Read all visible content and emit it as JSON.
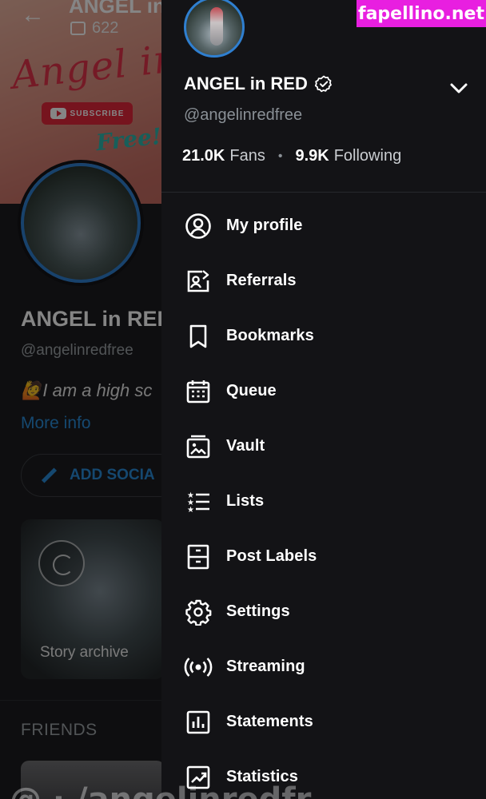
{
  "background": {
    "cover_title": "ANGEL in RED",
    "cover_script": "Angel in Red",
    "cover_free": "Free!",
    "subscribe_label": "SUBSCRIBE",
    "media_count": "622",
    "name": "ANGEL in RED",
    "handle": "@angelinredfree",
    "bio": "🙋I am a high sc",
    "more_info": "More info",
    "add_social": "ADD SOCIA",
    "story_label": "Story archive",
    "friends_heading": "FRIENDS"
  },
  "drawer": {
    "name": "ANGEL in RED",
    "handle": "@angelinredfree",
    "fans_count": "21.0K",
    "fans_label": "Fans",
    "following_count": "9.9K",
    "following_label": "Following",
    "menu": [
      {
        "label": "My profile",
        "icon": "profile-icon"
      },
      {
        "label": "Referrals",
        "icon": "referrals-icon"
      },
      {
        "label": "Bookmarks",
        "icon": "bookmark-icon"
      },
      {
        "label": "Queue",
        "icon": "calendar-icon"
      },
      {
        "label": "Vault",
        "icon": "vault-icon"
      },
      {
        "label": "Lists",
        "icon": "lists-icon"
      },
      {
        "label": "Post Labels",
        "icon": "post-labels-icon"
      },
      {
        "label": "Settings",
        "icon": "gear-icon"
      },
      {
        "label": "Streaming",
        "icon": "streaming-icon"
      },
      {
        "label": "Statements",
        "icon": "statements-icon"
      },
      {
        "label": "Statistics",
        "icon": "statistics-icon"
      }
    ]
  },
  "watermark": "fapellino.net",
  "bottom_ghost_text": "@ · /angelinredfr",
  "colors": {
    "drawer_bg": "#131316",
    "accent_blue": "#2a8bd6",
    "watermark_bg": "#e81fe0"
  }
}
